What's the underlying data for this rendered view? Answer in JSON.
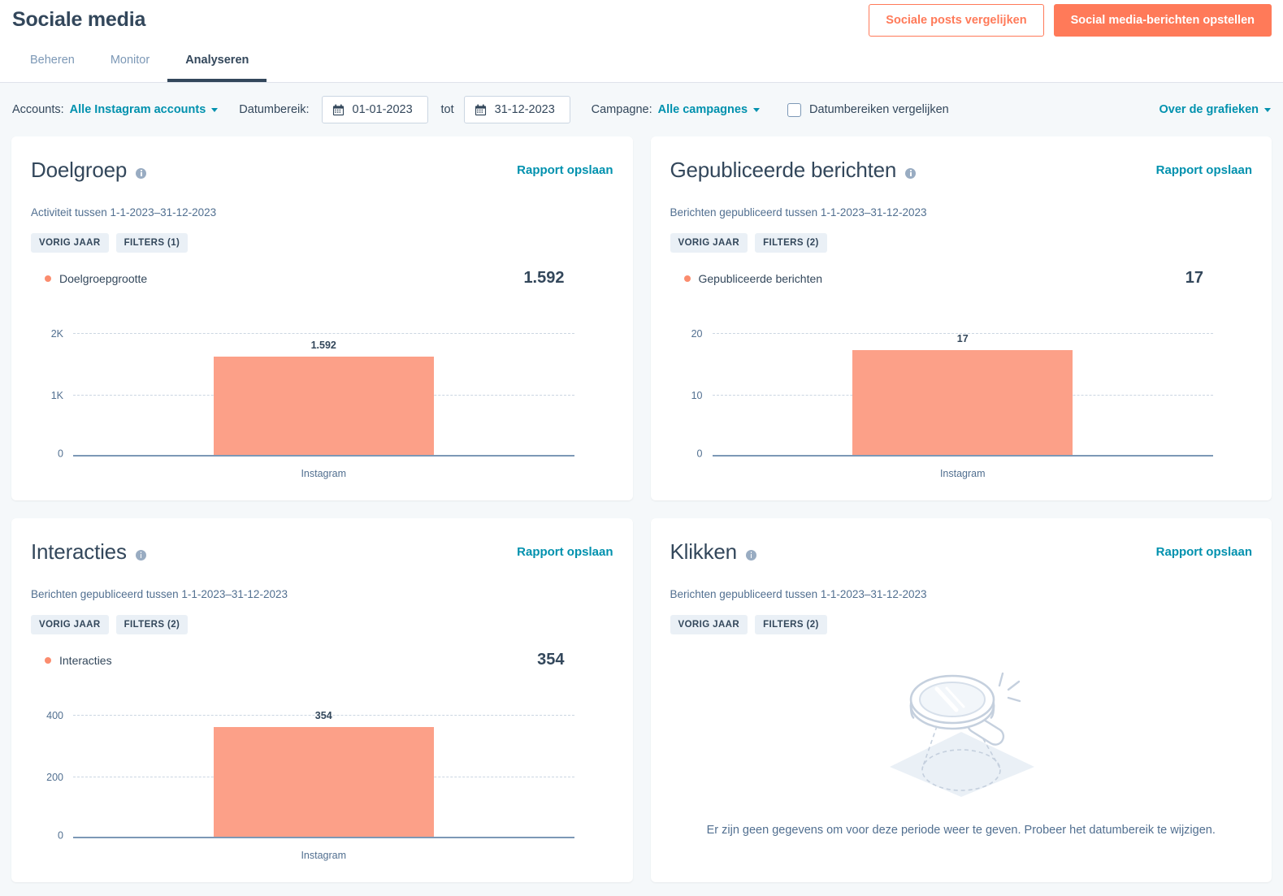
{
  "header": {
    "title": "Sociale media",
    "buttons": {
      "compare": "Sociale posts vergelijken",
      "create": "Social media-berichten opstellen"
    },
    "tabs": [
      {
        "label": "Beheren",
        "active": false
      },
      {
        "label": "Monitor",
        "active": false
      },
      {
        "label": "Analyseren",
        "active": true
      }
    ]
  },
  "filters": {
    "accounts_label": "Accounts:",
    "accounts_value": "Alle Instagram accounts",
    "daterange_label": "Datumbereik:",
    "date_from": "01-01-2023",
    "date_to": "31-12-2023",
    "tot_label": "tot",
    "campaign_label": "Campagne:",
    "campaign_value": "Alle campagnes",
    "compare_ranges_label": "Datumbereiken vergelijken",
    "about_charts": "Over de grafieken"
  },
  "common": {
    "save_report": "Rapport opslaan",
    "badge_prev_year": "VORIG JAAR"
  },
  "colors": {
    "accent_orange": "#FF7A59",
    "bar_orange": "#FCA088",
    "link_teal": "#0091AE",
    "text_dark": "#33475B",
    "page_bg": "#F5F8FA"
  },
  "cards": [
    {
      "title": "Doelgroep",
      "subtitle": "Activiteit tussen 1-1-2023–31-12-2023",
      "badges": [
        "VORIG JAAR",
        "FILTERS (1)"
      ],
      "legend_label": "Doelgroepgrootte",
      "total": "1.592"
    },
    {
      "title": "Gepubliceerde berichten",
      "subtitle": "Berichten gepubliceerd tussen 1-1-2023–31-12-2023",
      "badges": [
        "VORIG JAAR",
        "FILTERS (2)"
      ],
      "legend_label": "Gepubliceerde berichten",
      "total": "17"
    },
    {
      "title": "Interacties",
      "subtitle": "Berichten gepubliceerd tussen 1-1-2023–31-12-2023",
      "badges": [
        "VORIG JAAR",
        "FILTERS (2)"
      ],
      "legend_label": "Interacties",
      "total": "354"
    },
    {
      "title": "Klikken",
      "subtitle": "Berichten gepubliceerd tussen 1-1-2023–31-12-2023",
      "badges": [
        "VORIG JAAR",
        "FILTERS (2)"
      ],
      "empty_message": "Er zijn geen gegevens om voor deze periode weer te geven. Probeer het datumbereik te wijzigen."
    }
  ],
  "chart_data": [
    {
      "type": "bar",
      "title": "Doelgroep",
      "categories": [
        "Instagram"
      ],
      "values": [
        1592
      ],
      "data_labels": [
        "1.592"
      ],
      "yticks": [
        0,
        1000,
        2000
      ],
      "ytick_labels": [
        "0",
        "1K",
        "2K"
      ],
      "ylim": [
        0,
        2000
      ],
      "xlabel": "",
      "ylabel": "",
      "series": [
        {
          "name": "Doelgroepgrootte",
          "values": [
            1592
          ],
          "color": "#FCA088"
        }
      ],
      "grid": true,
      "legend_position": "top-left"
    },
    {
      "type": "bar",
      "title": "Gepubliceerde berichten",
      "categories": [
        "Instagram"
      ],
      "values": [
        17
      ],
      "data_labels": [
        "17"
      ],
      "yticks": [
        0,
        10,
        20
      ],
      "ytick_labels": [
        "0",
        "10",
        "20"
      ],
      "ylim": [
        0,
        20
      ],
      "xlabel": "",
      "ylabel": "",
      "series": [
        {
          "name": "Gepubliceerde berichten",
          "values": [
            17
          ],
          "color": "#FCA088"
        }
      ],
      "grid": true,
      "legend_position": "top-left"
    },
    {
      "type": "bar",
      "title": "Interacties",
      "categories": [
        "Instagram"
      ],
      "values": [
        354
      ],
      "data_labels": [
        "354"
      ],
      "yticks": [
        0,
        200,
        400
      ],
      "ytick_labels": [
        "0",
        "200",
        "400"
      ],
      "ylim": [
        0,
        400
      ],
      "xlabel": "",
      "ylabel": "",
      "series": [
        {
          "name": "Interacties",
          "values": [
            354
          ],
          "color": "#FCA088"
        }
      ],
      "grid": true,
      "legend_position": "top-left"
    },
    {
      "type": "bar",
      "title": "Klikken",
      "categories": [],
      "values": [],
      "data_labels": [],
      "yticks": [],
      "ytick_labels": [],
      "xlabel": "",
      "ylabel": "",
      "series": [],
      "grid": false,
      "empty": true,
      "empty_message": "Er zijn geen gegevens om voor deze periode weer te geven. Probeer het datumbereik te wijzigen."
    }
  ]
}
